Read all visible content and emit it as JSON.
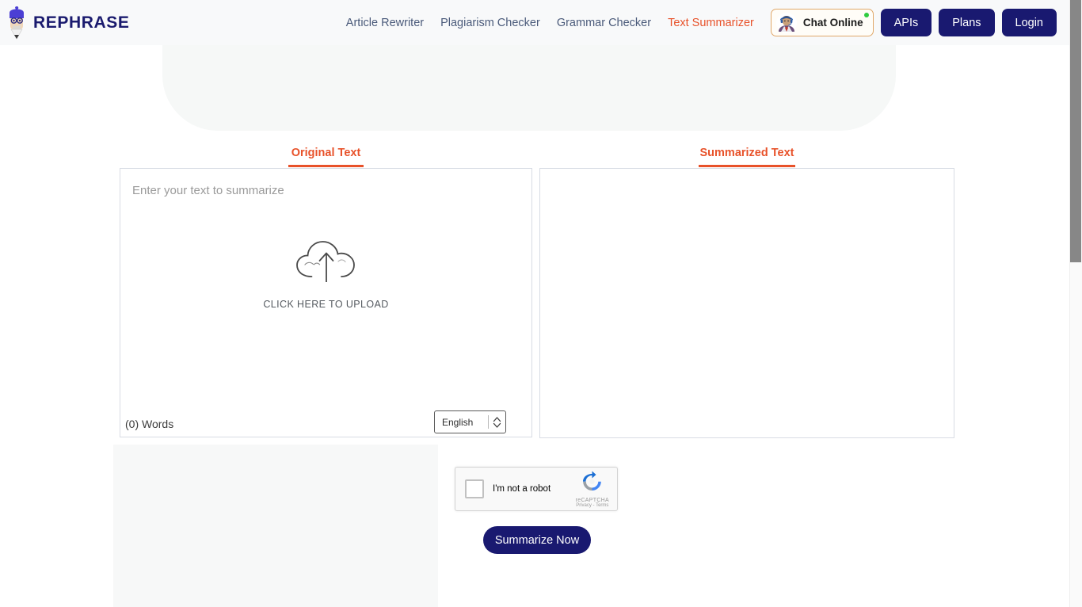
{
  "header": {
    "brand_name": "REPHRASE",
    "brand_icon": "rephrase-mascot-icon",
    "nav_links": [
      {
        "label": "Article Rewriter",
        "active": false
      },
      {
        "label": "Plagiarism Checker",
        "active": false
      },
      {
        "label": "Grammar Checker",
        "active": false
      },
      {
        "label": "Text Summarizer",
        "active": true
      }
    ],
    "chat": {
      "label": "Chat Online",
      "avatar_icon": "support-agent-avatar-icon",
      "status_icon": "online-status-dot"
    },
    "buttons": [
      {
        "label": "APIs"
      },
      {
        "label": "Plans"
      },
      {
        "label": "Login"
      }
    ]
  },
  "tabs": {
    "original": "Original Text",
    "summarized": "Summarized Text"
  },
  "editor": {
    "placeholder": "Enter your text to summarize",
    "upload_caption": "CLICK HERE TO UPLOAD",
    "upload_icon": "cloud-upload-icon",
    "word_count": "(0) Words",
    "language_value": "English",
    "stepper_icon": "up-down-chevron-icon"
  },
  "summary": {
    "content": ""
  },
  "captcha": {
    "label": "I'm not a robot",
    "brand_name": "reCAPTCHA",
    "brand_legal": "Privacy - Terms",
    "logo_icon": "recaptcha-logo-icon"
  },
  "actions": {
    "submit_label": "Summarize Now"
  },
  "colors": {
    "accent_orange": "#e8522a",
    "brand_navy": "#191970",
    "nav_text": "#4a5a7a",
    "header_bg": "#f8f9fa",
    "panel_border": "#d8dce4"
  }
}
